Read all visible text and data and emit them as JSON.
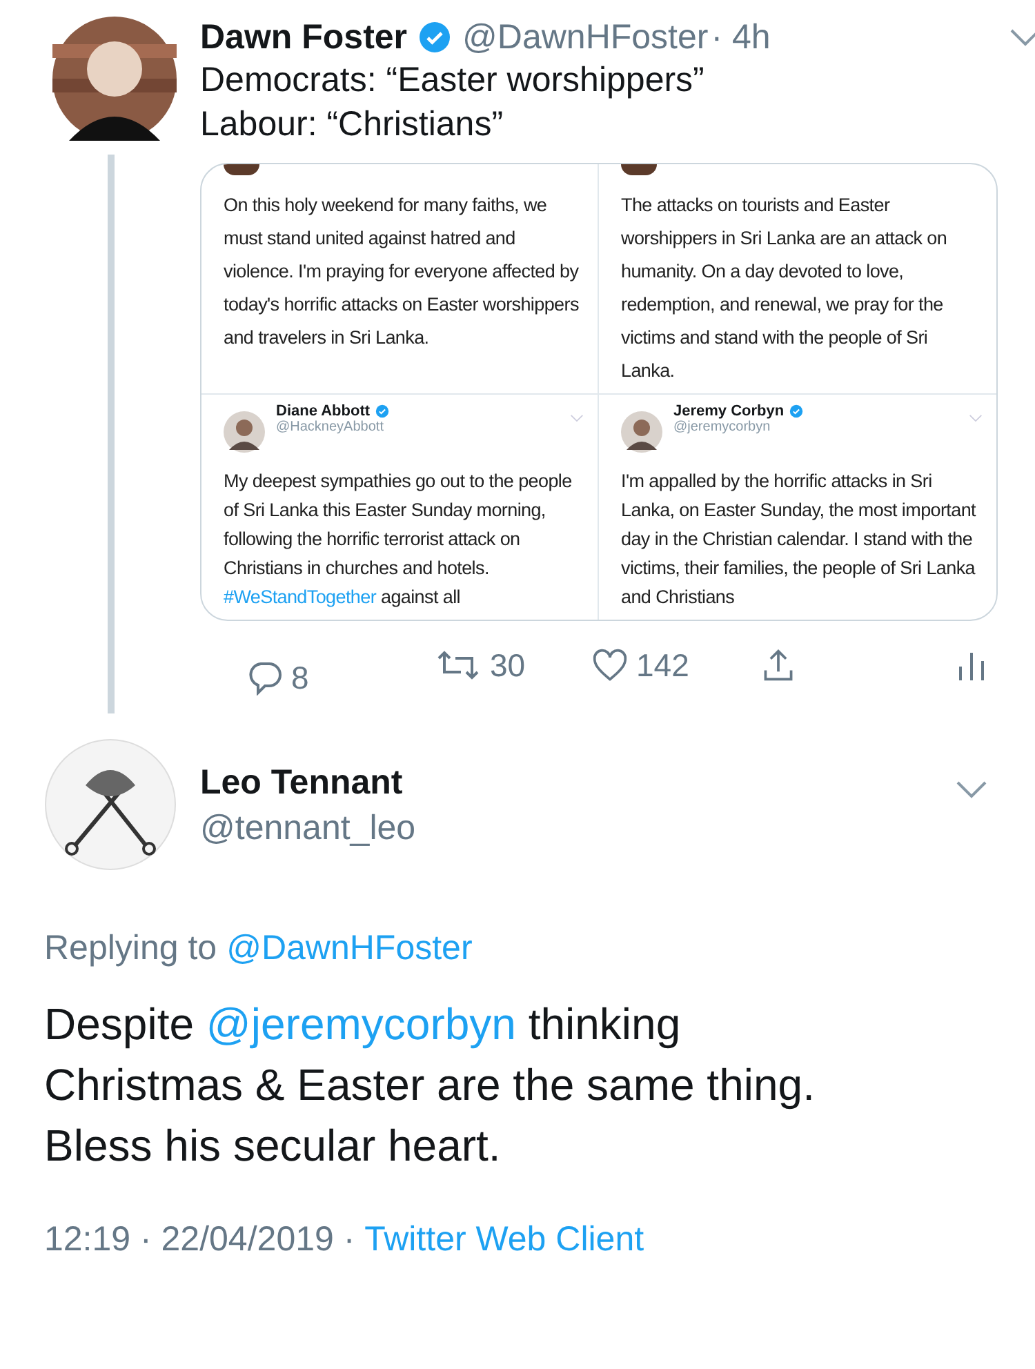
{
  "tweet": {
    "name": "Dawn Foster",
    "verified": true,
    "handle": "@DawnHFoster",
    "time": "· 4h",
    "lines": [
      "Democrats: “Easter worshippers”",
      "Labour: “Christians”"
    ],
    "embedded": [
      {
        "kind": "text",
        "body": "On this holy weekend for many faiths, we must stand united against hatred and violence. I'm praying for everyone affected by today's horrific attacks on Easter worshippers and travelers in Sri Lanka."
      },
      {
        "kind": "text",
        "body": "The attacks on tourists and Easter worshippers in Sri Lanka are an attack on humanity. On a day devoted to love, redemption, and renewal, we pray for the victims and stand with the people of Sri Lanka."
      },
      {
        "kind": "tweet",
        "name": "Diane Abbott",
        "verified": true,
        "handle": "@HackneyAbbott",
        "body": "My deepest sympathies go out to the people of Sri Lanka this Easter Sunday morning, following the horrific terrorist attack on Christians in churches and hotels.",
        "tag": "#WeStandTogether",
        "rest": "against all"
      },
      {
        "kind": "tweet",
        "name": "Jeremy Corbyn",
        "verified": true,
        "handle": "@jeremycorbyn",
        "body": "I'm appalled by the horrific attacks in Sri Lanka, on Easter Sunday, the most important day in the Christian calendar. I stand with the victims, their families, the people of Sri Lanka and Christians"
      }
    ],
    "actions": [
      {
        "kind": "reply",
        "count": "8"
      },
      {
        "kind": "retweet",
        "count": "30"
      },
      {
        "kind": "like",
        "count": "142"
      },
      {
        "kind": "share"
      },
      {
        "kind": "stats"
      }
    ]
  },
  "reply": {
    "name": "Leo Tennant",
    "handle": "@tennant_leo",
    "replying_label": "Replying to",
    "replying_to": "@DawnHFoster",
    "text": [
      {
        "t": "Despite ",
        "link": false
      },
      {
        "t": "@jeremycorbyn",
        "link": true
      },
      {
        "t": " thinking\nChristmas & Easter are the same thing.\nBless his secular heart.",
        "link": false
      }
    ],
    "time": "12:19 · 22/04/2019 ·",
    "source": "Twitter Web Client"
  }
}
